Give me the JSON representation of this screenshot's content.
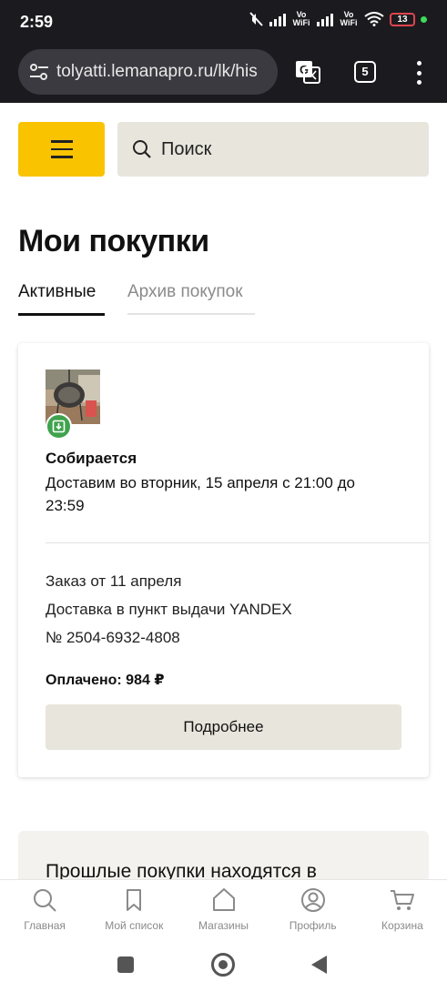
{
  "status_bar": {
    "time": "2:59",
    "vowifi_label": "Vo WiFi",
    "battery_level": "13"
  },
  "browser": {
    "url": "tolyatti.lemanapro.ru/lk/his",
    "tab_count": "5"
  },
  "header": {
    "search_placeholder": "Поиск"
  },
  "page": {
    "title": "Мои покупки",
    "tabs": [
      {
        "label": "Активные",
        "active": true
      },
      {
        "label": "Архив покупок",
        "active": false
      }
    ]
  },
  "order": {
    "status": "Собирается",
    "delivery_text": "Доставим во вторник, 15 апреля с 21:00 до 23:59",
    "order_date": "Заказ от 11 апреля",
    "delivery_method": "Доставка в пункт выдачи YANDEX",
    "order_number": "№ 2504-6932-4808",
    "paid": "Оплачено: 984 ₽",
    "details_button": "Подробнее"
  },
  "past_purchases": {
    "text": "Прошлые покупки находятся в"
  },
  "bottom_nav": {
    "items": [
      {
        "label": "Главная",
        "icon": "search-icon"
      },
      {
        "label": "Мой список",
        "icon": "bookmark-icon"
      },
      {
        "label": "Магазины",
        "icon": "home-icon"
      },
      {
        "label": "Профиль",
        "icon": "profile-icon"
      },
      {
        "label": "Корзина",
        "icon": "cart-icon"
      }
    ]
  },
  "colors": {
    "brand_yellow": "#f9c300",
    "button_beige": "#e8e5dc",
    "badge_green": "#3fa34d"
  }
}
